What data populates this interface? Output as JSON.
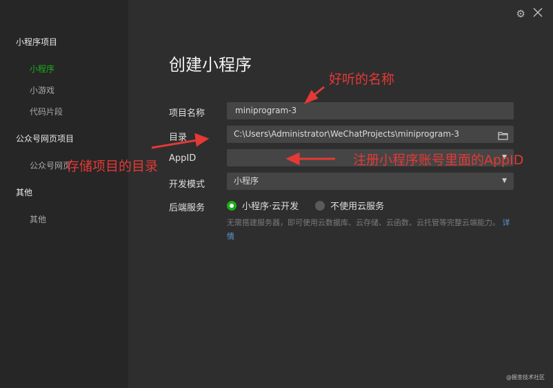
{
  "sidebar": {
    "section_miniprogram": "小程序项目",
    "item_miniprogram": "小程序",
    "item_minigame": "小游戏",
    "item_snippet": "代码片段",
    "section_webpage": "公众号网页项目",
    "item_webpage": "公众号网页",
    "section_other": "其他",
    "item_other": "其他"
  },
  "main": {
    "title": "创建小程序",
    "project_name_label": "项目名称",
    "project_name_value": "miniprogram-3",
    "directory_label": "目录",
    "directory_value": "C:\\Users\\Administrator\\WeChatProjects\\miniprogram-3",
    "appid_label": "AppID",
    "appid_value": "",
    "dev_mode_label": "开发模式",
    "dev_mode_value": "小程序",
    "backend_label": "后端服务",
    "option_cloud": "小程序·云开发",
    "option_no_cloud": "不使用云服务",
    "hint_text": "无需搭建服务器，即可使用云数据库、云存储、云函数、云托管等完整云端能力。",
    "hint_link": "详情"
  },
  "annotations": {
    "name_hint": "好听的名称",
    "dir_hint": "存储项目的目录",
    "appid_hint": "注册小程序账号里面的AppID"
  },
  "watermark": "@掘金技术社区",
  "colors": {
    "accent": "#1aad19",
    "link": "#5b9bd5",
    "annotation": "#e53935",
    "background": "#2e2e2e",
    "sidebar": "#262626"
  },
  "icons": {
    "settings": "gear-icon",
    "close": "close-icon",
    "folder": "folder-icon",
    "dropdown": "chevron-down-icon"
  }
}
